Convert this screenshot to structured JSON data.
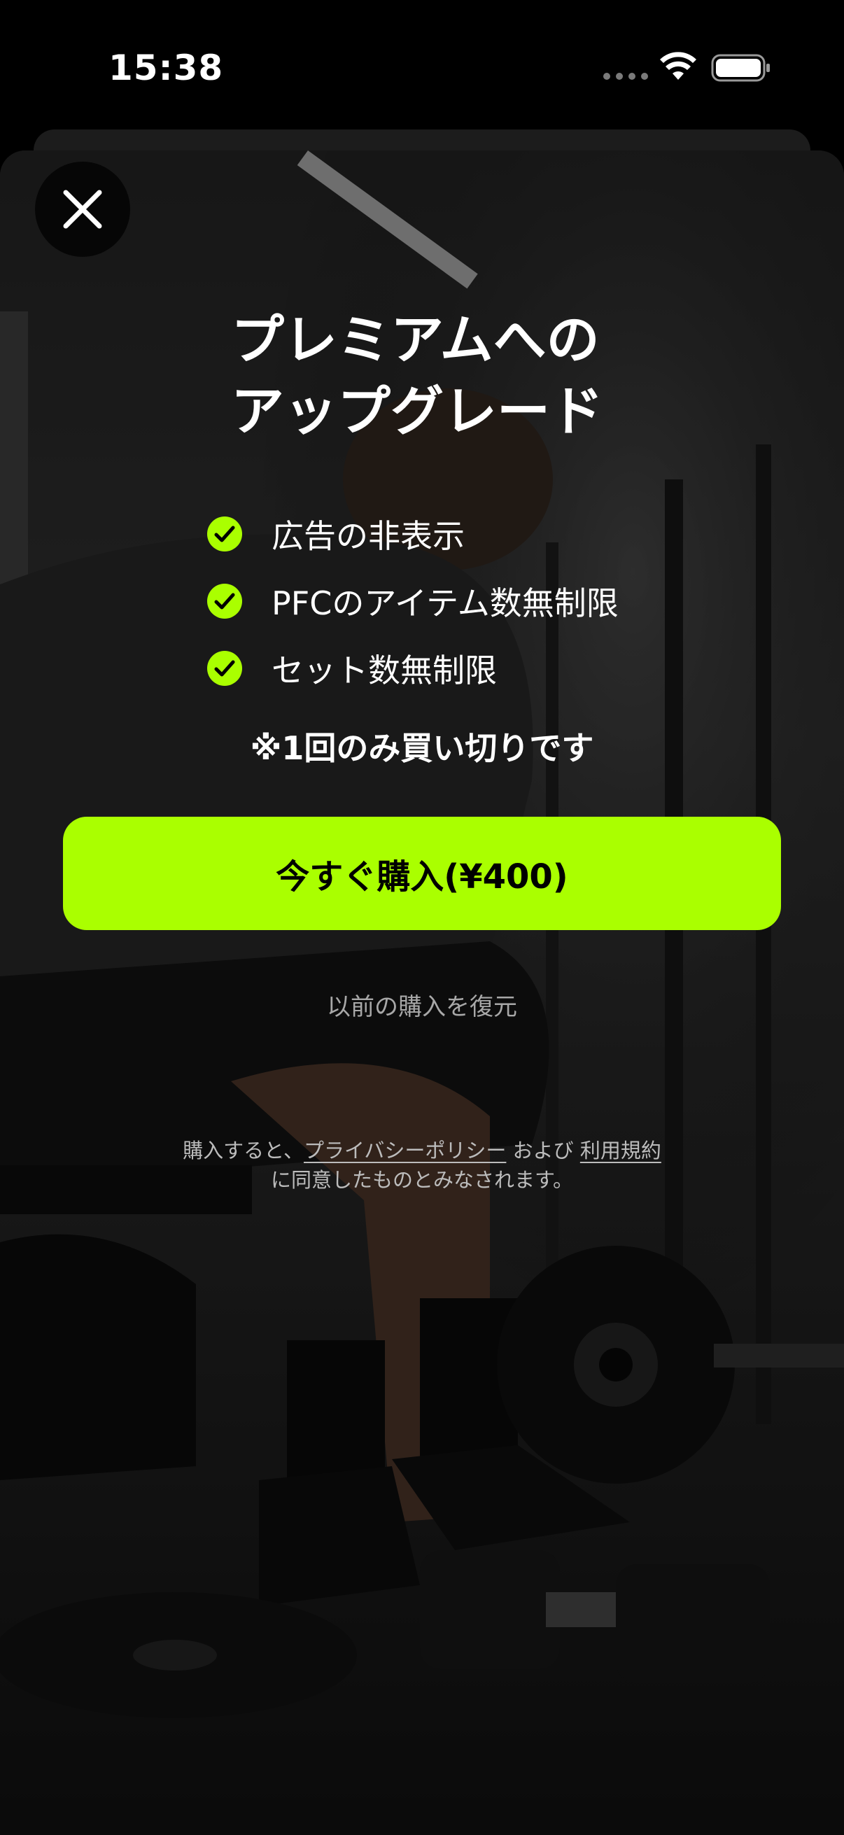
{
  "status_bar": {
    "time": "15:38"
  },
  "paywall": {
    "title_line1": "プレミアムへの",
    "title_line2": "アップグレード",
    "features": [
      {
        "label": "広告の非表示",
        "icon": "check-icon"
      },
      {
        "label": "PFCのアイテム数無制限",
        "icon": "check-icon"
      },
      {
        "label": "セット数無制限",
        "icon": "check-icon"
      }
    ],
    "note": "※1回のみ買い切りです",
    "buy_button_label": "今すぐ購入(¥400)",
    "restore_label": "以前の購入を復元",
    "legal": {
      "prefix": "購入すると、",
      "privacy_link": "プライバシーポリシー",
      "and": " および ",
      "terms_link": "利用規約",
      "suffix": "に同意したものとみなされます。"
    }
  },
  "colors": {
    "accent": "#aaff00",
    "background": "#000000",
    "muted_text": "#a8a8a8"
  },
  "icons": {
    "close": "close-icon",
    "wifi": "wifi-icon",
    "battery": "battery-icon"
  }
}
